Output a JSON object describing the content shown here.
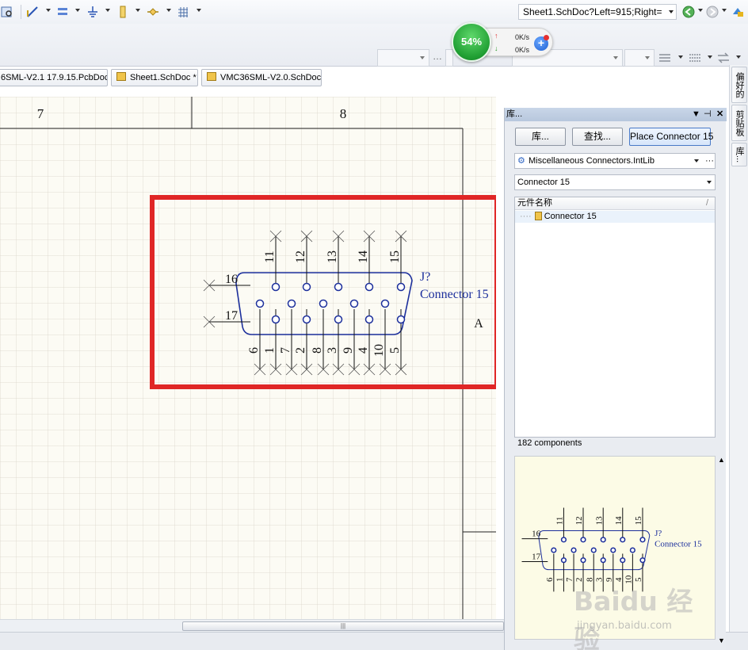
{
  "toolbar": {
    "address": "Sheet1.SchDoc?Left=915;Right=",
    "icon_names": [
      "inspect-icon",
      "wire-tool-icon",
      "bus-tool-icon",
      "ground-icon",
      "port-icon",
      "junction-icon",
      "grid-icon",
      "nav-back-icon",
      "nav-forward-icon",
      "plugin-icon"
    ]
  },
  "net_widget": {
    "percent": "54%",
    "upload": "0K/s",
    "download": "0K/s"
  },
  "doc_tabs": [
    {
      "label": "6SML-V2.1 17.9.15.PcbDoc"
    },
    {
      "label": "Sheet1.SchDoc *"
    },
    {
      "label": "VMC36SML-V2.0.SchDoc"
    }
  ],
  "side_tabs": [
    "偏好的",
    "剪贴板",
    "库..."
  ],
  "schematic": {
    "zone_labels": [
      "7",
      "8"
    ],
    "row_label": "A",
    "designator": "J?",
    "comment": "Connector 15",
    "top_pins": [
      "11",
      "12",
      "13",
      "14",
      "15"
    ],
    "left_pins": [
      "16",
      "17"
    ],
    "bottom_pins": [
      "6",
      "1",
      "7",
      "2",
      "8",
      "3",
      "9",
      "4",
      "10",
      "5"
    ]
  },
  "library_panel": {
    "title": "库...",
    "buttons": {
      "library": "库...",
      "search": "查找...",
      "place": "Place Connector 15"
    },
    "library_name": "Miscellaneous Connectors.IntLib",
    "filter": "Connector 15",
    "list_header": "元件名称",
    "components": [
      "Connector 15"
    ],
    "count": "182 components"
  },
  "watermark": {
    "brand": "Baidu 经验",
    "url": "jingyan.baidu.com"
  }
}
